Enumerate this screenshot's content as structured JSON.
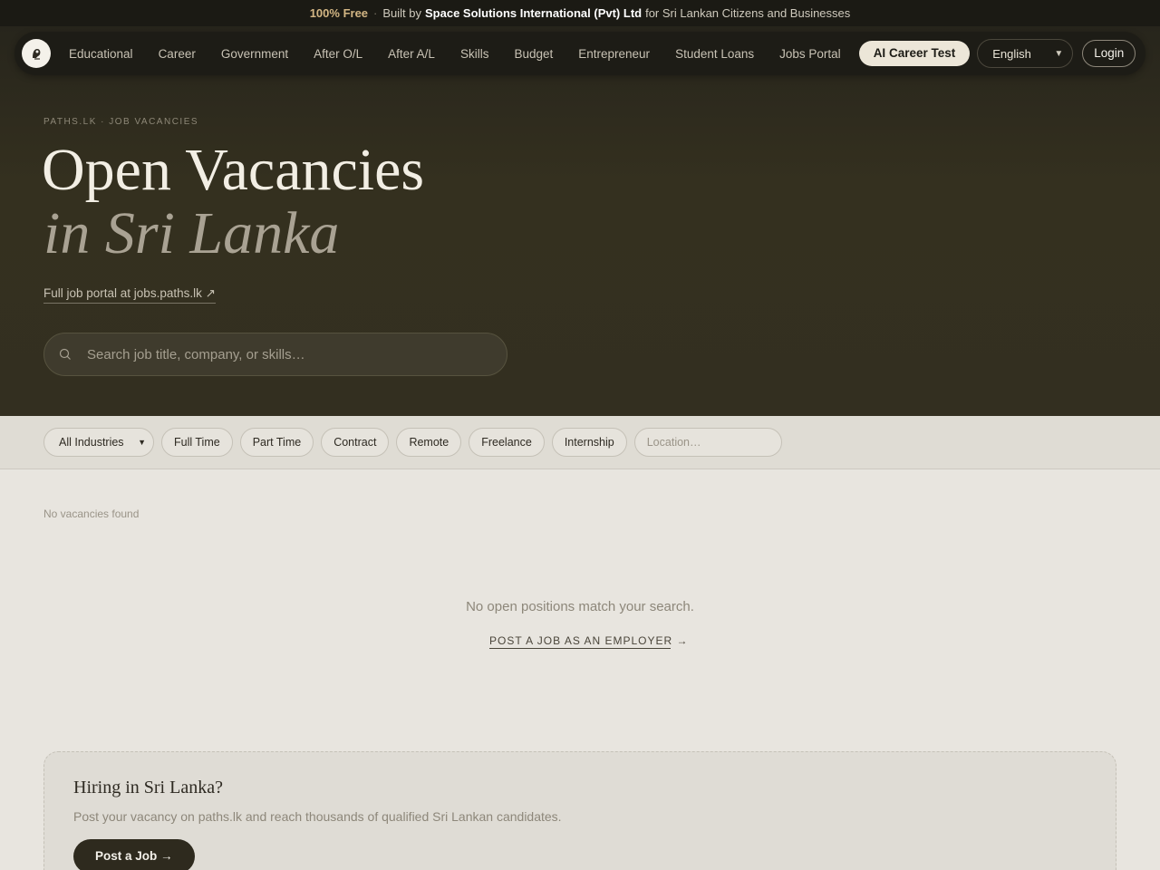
{
  "announcement": {
    "free": "100% Free",
    "separator": "·",
    "built_by": "Built by",
    "company": "Space Solutions International (Pvt) Ltd",
    "for_text": "for Sri Lankan Citizens and Businesses"
  },
  "nav": {
    "logo_icon": "paths-lk-logo",
    "links": [
      "Educational",
      "Career",
      "Government",
      "After O/L",
      "After A/L",
      "Skills",
      "Budget",
      "Entrepreneur",
      "Student Loans",
      "Jobs Portal"
    ],
    "cta": "AI Career Test",
    "language": "English",
    "login": "Login"
  },
  "hero": {
    "breadcrumb": "PATHS.LK · JOB VACANCIES",
    "title_line1": "Open Vacancies",
    "title_line2": "in Sri Lanka",
    "portal_link": "Full job portal at jobs.paths.lk ↗",
    "search_placeholder": "Search job title, company, or skills…"
  },
  "filters": {
    "industry": "All Industries",
    "types": [
      "Full Time",
      "Part Time",
      "Contract",
      "Remote",
      "Freelance",
      "Internship"
    ],
    "location_placeholder": "Location…"
  },
  "results": {
    "count_text": "No vacancies found",
    "empty_message": "No open positions match your search.",
    "post_link": "POST A JOB AS AN EMPLOYER →"
  },
  "hiring": {
    "title": "Hiring in Sri Lanka?",
    "description": "Post your vacancy on paths.lk and reach thousands of qualified Sri Lankan candidates.",
    "button": "Post a Job →"
  },
  "colors": {
    "hero_bg": "#332f20",
    "accent_free": "#d3b684",
    "page_bg": "#e8e5df"
  }
}
